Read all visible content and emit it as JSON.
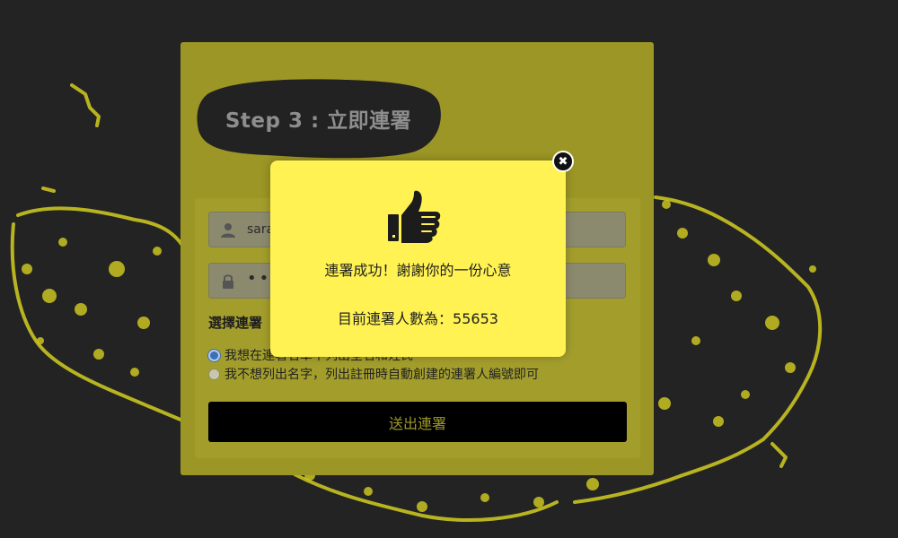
{
  "card": {
    "step_title": "Step 3 : 立即連署",
    "username_value": "sara",
    "password_mask": "•••",
    "choice_heading": "選擇連署",
    "options": [
      {
        "label": "我想在連署名單中列出全名和姓氏",
        "selected": true
      },
      {
        "label": "我不想列出名字，列出註冊時自動創建的連署人編號即可",
        "selected": false
      }
    ],
    "submit_label": "送出連署"
  },
  "modal": {
    "message": "連署成功！謝謝你的一份心意",
    "count_label": "目前連署人數為：",
    "count_value": "55653",
    "close_icon": "close-icon"
  },
  "icons": {
    "user": "user-icon",
    "lock": "lock-icon",
    "thumb": "thumbs-up-icon"
  },
  "colors": {
    "background": "#232323",
    "map_yellow": "#c9c321",
    "card": "#9c9626",
    "modal": "#fff252",
    "button": "#000000"
  }
}
